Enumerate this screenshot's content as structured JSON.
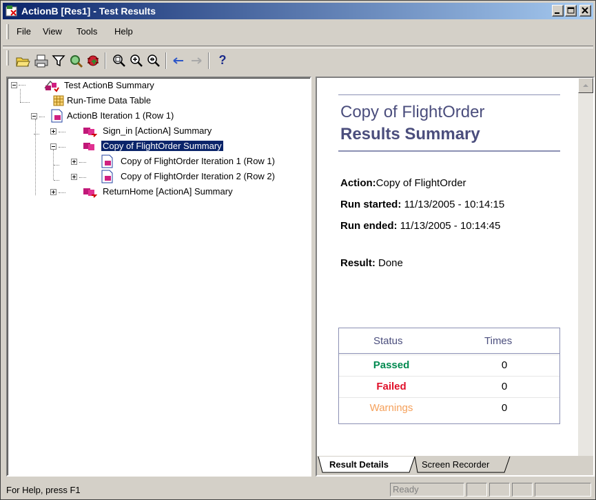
{
  "window": {
    "title": "ActionB [Res1] - Test Results"
  },
  "menu": {
    "items": [
      "File",
      "View",
      "Tools",
      "Help"
    ]
  },
  "toolbar": {
    "buttons": [
      "open-icon",
      "print-icon",
      "filter-icon",
      "find-icon",
      "bug-icon",
      "zoom-icon",
      "zoom-in-icon",
      "zoom-out-icon",
      "back-icon",
      "forward-icon",
      "help-icon"
    ],
    "help_label": "?"
  },
  "tree": {
    "items": [
      {
        "label": "Test ActionB Summary",
        "icon": "test-summary-icon"
      },
      {
        "label": "Run-Time Data Table",
        "icon": "data-table-icon"
      },
      {
        "label": "ActionB Iteration 1 (Row 1)",
        "icon": "iteration-icon"
      },
      {
        "label": "Sign_in [ActionA] Summary",
        "icon": "action-icon"
      },
      {
        "label": "Copy of FlightOrder Summary",
        "icon": "action-icon",
        "selected": true
      },
      {
        "label": "Copy of FlightOrder Iteration 1 (Row 1)",
        "icon": "iteration-icon"
      },
      {
        "label": "Copy of FlightOrder Iteration 2 (Row 2)",
        "icon": "iteration-icon"
      },
      {
        "label": "ReturnHome [ActionA] Summary",
        "icon": "action-icon"
      }
    ]
  },
  "details": {
    "title_line1": "Copy of FlightOrder",
    "title_line2": "Results Summary",
    "action_label": "Action:",
    "action_value": "Copy of FlightOrder",
    "run_started_label": "Run started:",
    "run_started_value": " 11/13/2005 - 10:14:15",
    "run_ended_label": "Run ended:",
    "run_ended_value": " 11/13/2005 - 10:14:45",
    "result_label": "Result:",
    "result_value": " Done",
    "table": {
      "headers": [
        "Status",
        "Times"
      ],
      "rows": [
        {
          "status": "Passed",
          "times": "0",
          "color": "#008a50"
        },
        {
          "status": "Failed",
          "times": "0",
          "color": "#e0102a"
        },
        {
          "status": "Warnings",
          "times": "0",
          "color": "#f5a05a"
        }
      ]
    }
  },
  "tabs": [
    "Result Details",
    "Screen Recorder"
  ],
  "status": {
    "help": "For Help, press F1",
    "ready": "Ready"
  }
}
